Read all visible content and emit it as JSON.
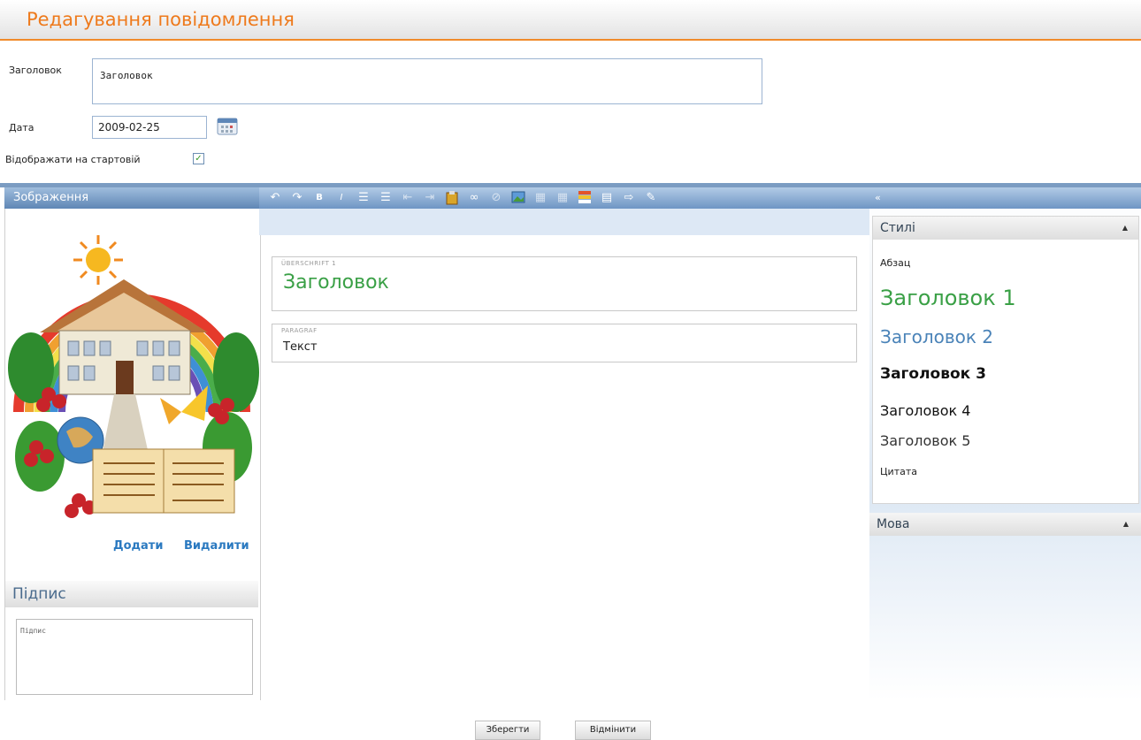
{
  "page": {
    "title": "Редагування повідомлення"
  },
  "form": {
    "headline_label": "Заголовок",
    "headline_value": "Заголовок",
    "date_label": "Дата",
    "date_value": "2009-02-25",
    "startpage_label": "Відображати на стартовій",
    "startpage_checked": true
  },
  "image_panel": {
    "title": "Зображення",
    "add_link": "Додати",
    "delete_link": "Видалити"
  },
  "caption_panel": {
    "title": "Підпис",
    "value": "Підпис"
  },
  "editor": {
    "toolbar_icons": [
      "undo-icon",
      "redo-icon",
      "bold-icon",
      "italic-icon",
      "numbered-list-icon",
      "bullet-list-icon",
      "outdent-icon",
      "indent-icon",
      "paste-icon",
      "link-icon",
      "unlink-icon",
      "image-icon",
      "table-insert-icon",
      "table-delete-icon",
      "color-icon",
      "table-icon",
      "insert-field-icon",
      "eraser-icon"
    ],
    "blocks": [
      {
        "tag": "ÜBERSCHRIFT 1",
        "text": "Заголовок"
      },
      {
        "tag": "PARAGRAF",
        "text": "Текст"
      }
    ]
  },
  "styles_panel": {
    "collapse_glyph": "«",
    "title": "Стилі",
    "items": [
      "Абзац",
      "Заголовок 1",
      "Заголовок 2",
      "Заголовок 3",
      "Заголовок 4",
      "Заголовок 5",
      "Цитата"
    ]
  },
  "language_panel": {
    "title": "Мова"
  },
  "buttons": {
    "save": "Зберегти",
    "cancel": "Відмінити"
  },
  "colors": {
    "accent": "#ee7a1c",
    "heading1": "#3aa046",
    "heading2": "#4a83b8",
    "link": "#2a79c0",
    "toolbar": "#6e95c4"
  }
}
